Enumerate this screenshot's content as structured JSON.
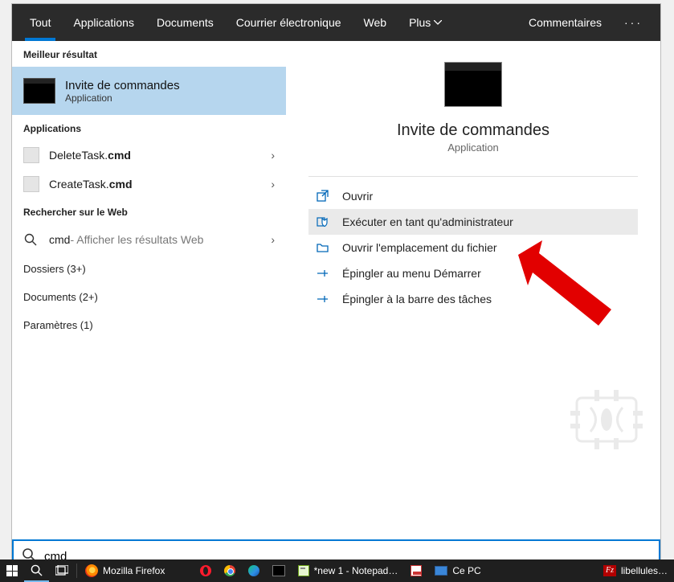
{
  "tabs": {
    "all": "Tout",
    "apps": "Applications",
    "docs": "Documents",
    "mail": "Courrier électronique",
    "web": "Web",
    "more": "Plus",
    "feedback": "Commentaires"
  },
  "left": {
    "best_header": "Meilleur résultat",
    "best": {
      "title": "Invite de commandes",
      "sub": "Application"
    },
    "apps_header": "Applications",
    "appitems": [
      {
        "plain": "DeleteTask.",
        "bold": "cmd"
      },
      {
        "plain": "CreateTask.",
        "bold": "cmd"
      }
    ],
    "web_header": "Rechercher sur le Web",
    "web": {
      "query": "cmd",
      "hint": " - Afficher les résultats Web"
    },
    "cats": {
      "folders": "Dossiers (3+)",
      "documents": "Documents (2+)",
      "settings": "Paramètres (1)"
    }
  },
  "right": {
    "title": "Invite de commandes",
    "sub": "Application",
    "actions": {
      "open": "Ouvrir",
      "admin": "Exécuter en tant qu'administrateur",
      "loc": "Ouvrir l'emplacement du fichier",
      "pin_start": "Épingler au menu Démarrer",
      "pin_tb": "Épingler à la barre des tâches"
    }
  },
  "search": {
    "value": "cmd"
  },
  "taskbar": {
    "firefox": "Mozilla Firefox",
    "notepad": "*new 1 - Notepad…",
    "pc": "Ce PC",
    "filezilla": "libellules…"
  }
}
